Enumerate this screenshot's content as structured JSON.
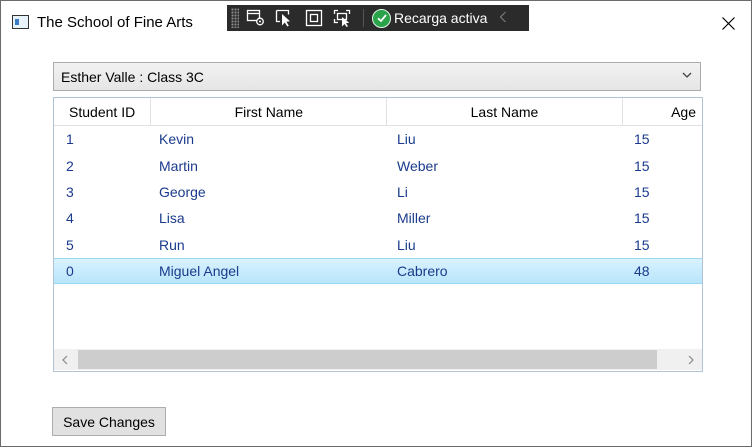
{
  "window": {
    "title": "The School of Fine Arts"
  },
  "devbar": {
    "hot_reload_label": "Recarga activa",
    "tools": [
      "select-element-icon",
      "pointer-icon",
      "layout-adorner-icon",
      "track-focus-icon"
    ]
  },
  "combo": {
    "selected": "Esther Valle : Class 3C"
  },
  "grid": {
    "columns": [
      "Student ID",
      "First Name",
      "Last Name",
      "Age"
    ],
    "rows": [
      {
        "id": "1",
        "first": "Kevin",
        "last": "Liu",
        "age": "15",
        "selected": false
      },
      {
        "id": "2",
        "first": "Martin",
        "last": "Weber",
        "age": "15",
        "selected": false
      },
      {
        "id": "3",
        "first": "George",
        "last": "Li",
        "age": "15",
        "selected": false
      },
      {
        "id": "4",
        "first": "Lisa",
        "last": "Miller",
        "age": "15",
        "selected": false
      },
      {
        "id": "5",
        "first": "Run",
        "last": "Liu",
        "age": "15",
        "selected": false
      },
      {
        "id": "0",
        "first": "Miguel Angel",
        "last": "Cabrero",
        "age": "48",
        "selected": true
      }
    ]
  },
  "actions": {
    "save_label": "Save Changes"
  },
  "colors": {
    "cell_text": "#1a3b8c",
    "selection": "#b8e5fb",
    "hot_reload_ok": "#2aa34a"
  }
}
